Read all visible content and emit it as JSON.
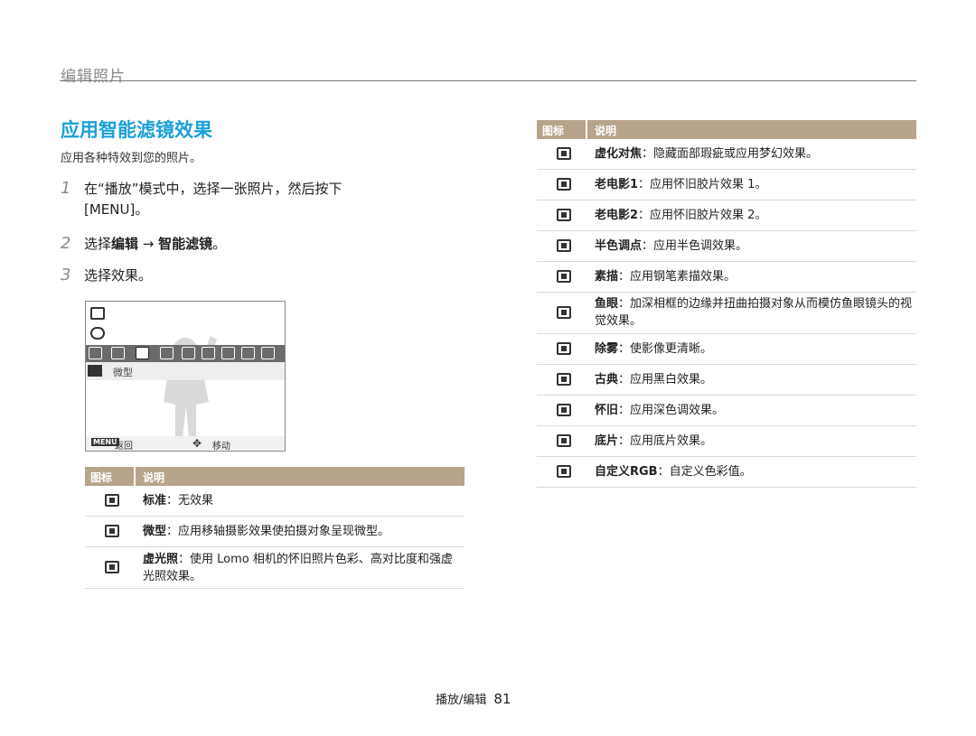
{
  "header": {
    "section": "编辑照片"
  },
  "title": "应用智能滤镜效果",
  "subtitle": "应用各种特效到您的照片。",
  "steps": [
    {
      "num": "1",
      "text": "在“播放”模式中，选择一张照片，然后按下 [MENU]。"
    },
    {
      "num": "2",
      "prefix": "选择",
      "bold1": "编辑",
      "arrow": " → ",
      "bold2": "智能滤镜",
      "suffix": "。"
    },
    {
      "num": "3",
      "text": "选择效果。"
    }
  ],
  "screen": {
    "band_label": "微型",
    "menu_key": "MENU",
    "back": "返回",
    "move": "移动"
  },
  "table_left": {
    "col_icon": "图标",
    "col_desc": "说明",
    "rows": [
      {
        "icon": "normal-filter-icon",
        "term": "标准",
        "desc": "：无效果"
      },
      {
        "icon": "miniature-icon",
        "term": "微型",
        "desc": "：应用移轴摄影效果使拍摄对象呈现微型。"
      },
      {
        "icon": "vignetting-icon",
        "term": "虚光照",
        "desc": "：使用 Lomo 相机的怀旧照片色彩、高对比度和强虚光照效果。"
      }
    ]
  },
  "table_right": {
    "col_icon": "图标",
    "col_desc": "说明",
    "rows": [
      {
        "icon": "soft-focus-icon",
        "term": "虚化对焦",
        "desc": "：隐藏面部瑕疵或应用梦幻效果。"
      },
      {
        "icon": "old-film1-icon",
        "term": "老电影1",
        "desc": "：应用怀旧胶片效果 1。"
      },
      {
        "icon": "old-film2-icon",
        "term": "老电影2",
        "desc": "：应用怀旧胶片效果 2。"
      },
      {
        "icon": "halftone-icon",
        "term": "半色调点",
        "desc": "：应用半色调效果。"
      },
      {
        "icon": "sketch-icon",
        "term": "素描",
        "desc": "：应用钢笔素描效果。"
      },
      {
        "icon": "fisheye-icon",
        "term": "鱼眼",
        "desc": "：加深相框的边缘并扭曲拍摄对象从而模仿鱼眼镜头的视觉效果。"
      },
      {
        "icon": "defog-icon",
        "term": "除雾",
        "desc": "：使影像更清晰。"
      },
      {
        "icon": "classic-icon",
        "term": "古典",
        "desc": "：应用黑白效果。"
      },
      {
        "icon": "retro-icon",
        "term": "怀旧",
        "desc": "：应用深色调效果。"
      },
      {
        "icon": "negative-icon",
        "term": "底片",
        "desc": "：应用底片效果。"
      },
      {
        "icon": "custom-rgb-icon",
        "term": "自定义RGB",
        "desc": "：自定义色彩值。"
      }
    ]
  },
  "footer": {
    "section": "播放/编辑",
    "page": "81"
  }
}
